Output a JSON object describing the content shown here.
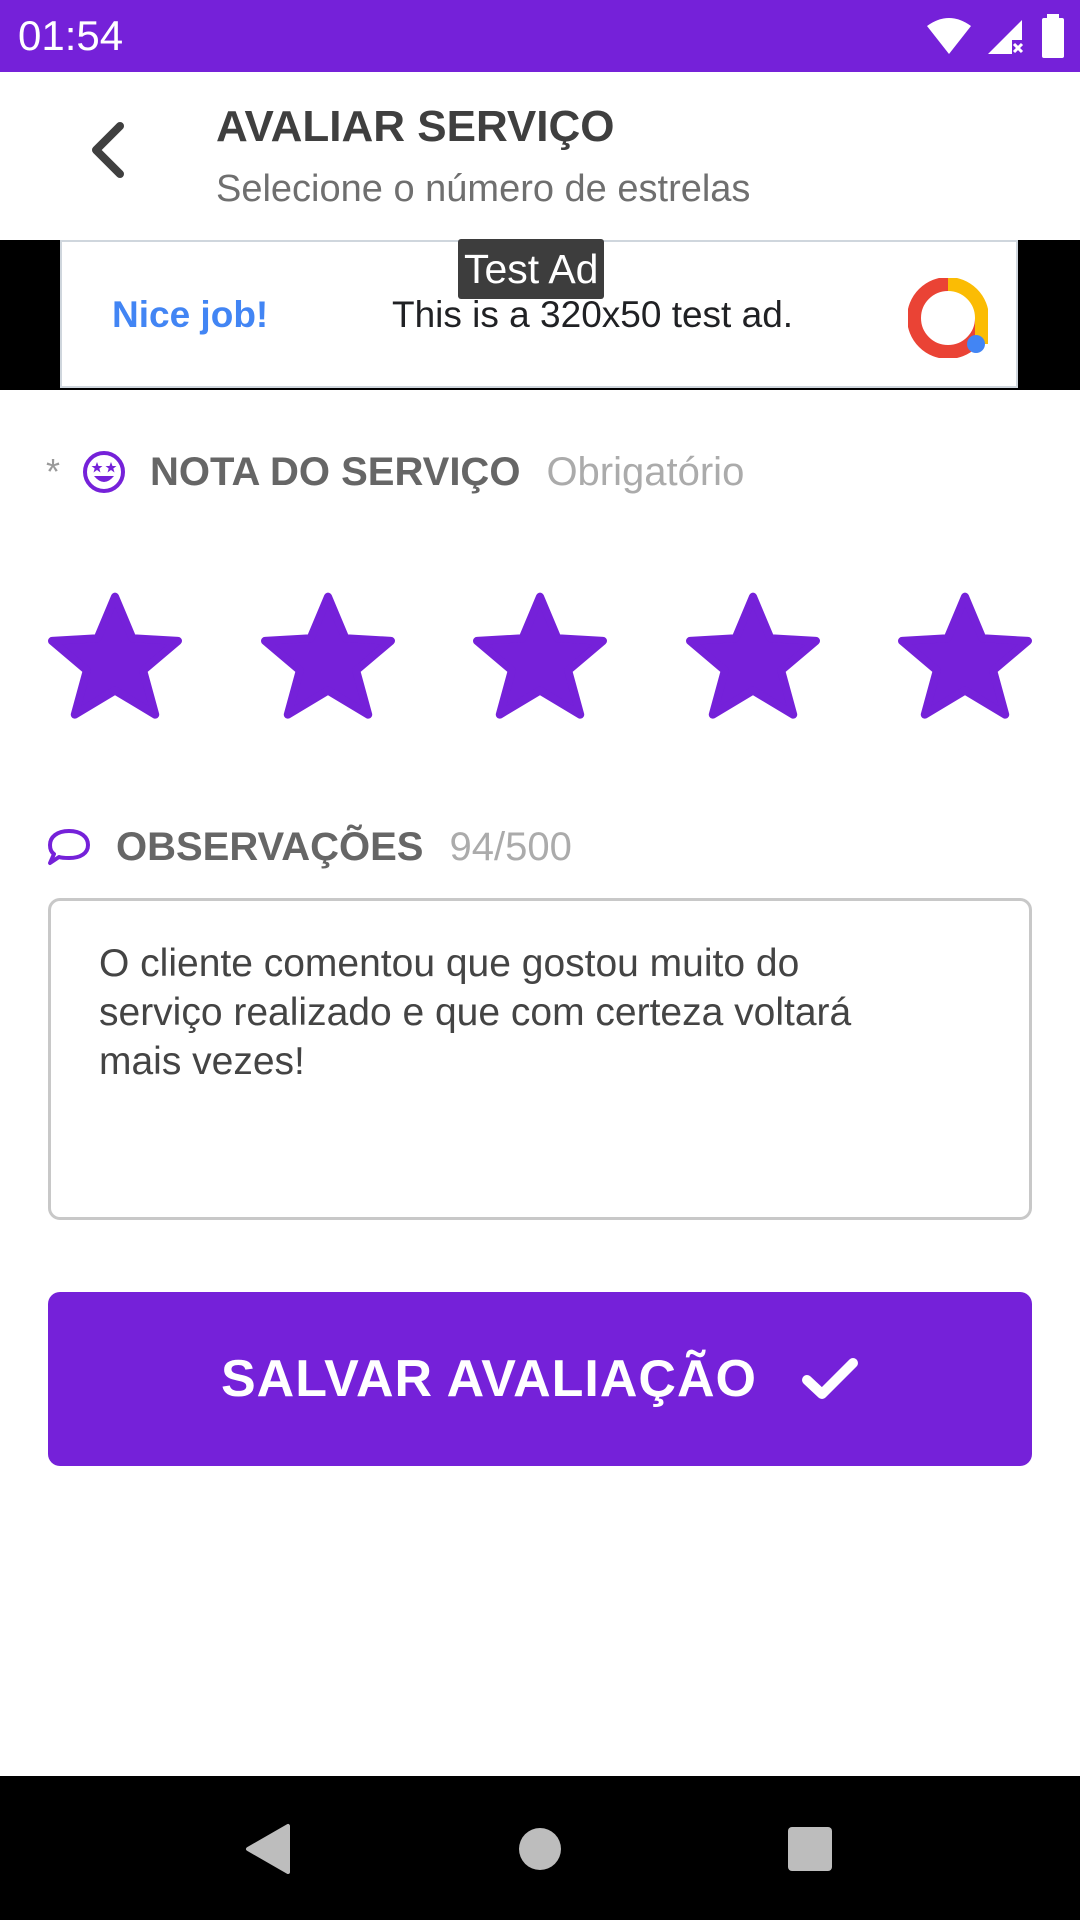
{
  "status_bar": {
    "time": "01:54",
    "background": "#7521D9"
  },
  "header": {
    "title": "AVALIAR SERVIÇO",
    "subtitle": "Selecione o número de estrelas",
    "back_icon": "chevron-left-icon"
  },
  "ad": {
    "badge": "Test Ad",
    "headline": "Nice job!",
    "text": "This is a 320x50 test ad."
  },
  "rating": {
    "required_marker": "*",
    "icon": "star-struck-face-icon",
    "label": "NOTA DO SERVIÇO",
    "required_note": "Obrigatório",
    "value": 5,
    "max": 5,
    "star_color": "#7521D9"
  },
  "observations": {
    "icon": "comment-icon",
    "label": "OBSERVAÇÕES",
    "counter": "94/500",
    "text": "O cliente comentou que gostou muito do\nserviço realizado e que com certeza voltará\nmais vezes!"
  },
  "save_button": {
    "label": "SALVAR AVALIAÇÃO",
    "icon": "check-icon"
  },
  "nav": {
    "back_icon": "nav-back-icon",
    "home_icon": "nav-home-icon",
    "recents_icon": "nav-recents-icon"
  }
}
